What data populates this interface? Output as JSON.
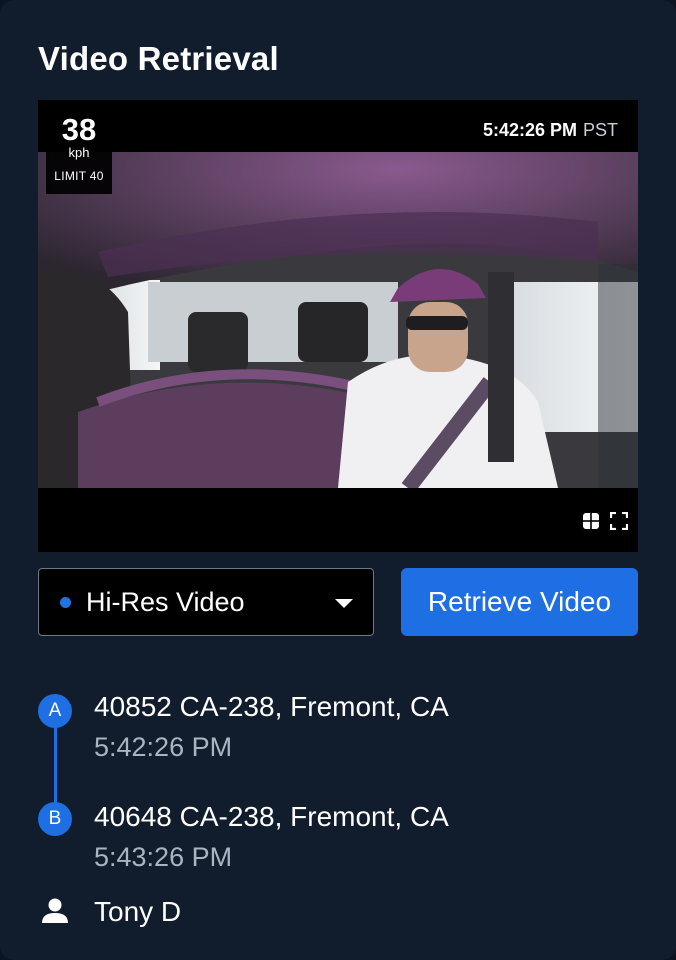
{
  "header": {
    "title": "Video Retrieval"
  },
  "video": {
    "speed_value": "38",
    "speed_unit": "kph",
    "speed_limit": "LIMIT 40",
    "time": "5:42:26 PM",
    "timezone": "PST",
    "controls": [
      "grid-view-icon",
      "fullscreen-icon"
    ]
  },
  "controls": {
    "quality_select": {
      "value": "Hi-Res Video",
      "dot_color": "#1f74e0"
    },
    "retrieve_label": "Retrieve Video"
  },
  "route": {
    "start": {
      "marker": "A",
      "address": "40852 CA-238, Fremont, CA",
      "time": "5:42:26 PM"
    },
    "end": {
      "marker": "B",
      "address": "40648 CA-238, Fremont, CA",
      "time": "5:43:26 PM"
    }
  },
  "driver": {
    "icon": "person-icon",
    "name": "Tony D"
  },
  "colors": {
    "background": "#111d2c",
    "accent": "#1d6fe3",
    "muted_text": "#aab4c2"
  }
}
